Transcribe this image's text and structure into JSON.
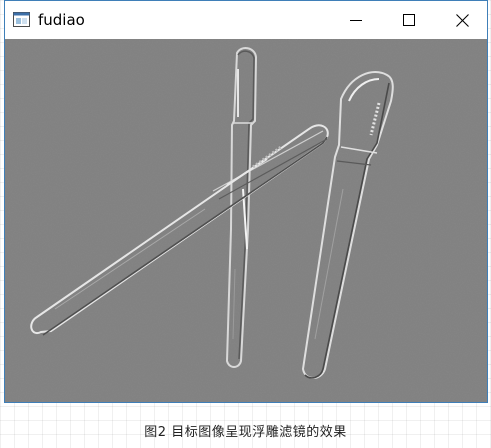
{
  "window": {
    "title": "fudiao",
    "icon": "app-window-icon",
    "controls": {
      "minimize": "minimize-icon",
      "maximize": "maximize-icon",
      "close": "close-icon"
    }
  },
  "canvas": {
    "content": "emboss-filtered-image-of-pens",
    "background_color": "#808080"
  },
  "caption": {
    "text": "图2   目标图像呈现浮雕滤镜的效果"
  }
}
